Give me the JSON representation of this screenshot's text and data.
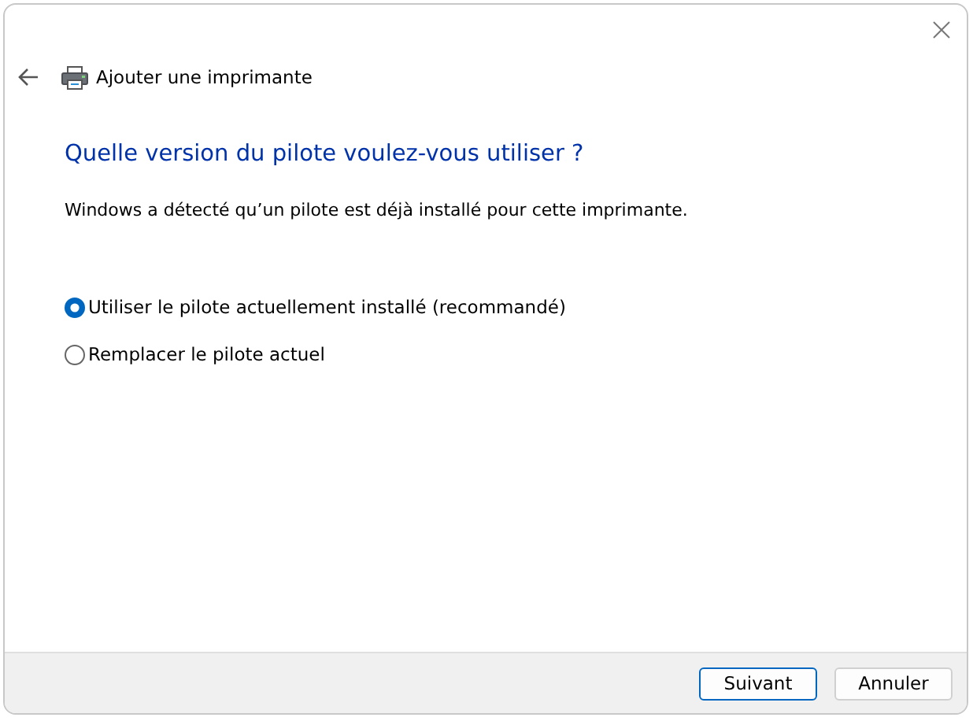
{
  "window": {
    "title": "Ajouter une imprimante"
  },
  "heading": "Quelle version du pilote voulez-vous utiliser ?",
  "description": "Windows a détecté qu’un pilote est déjà installé pour cette imprimante.",
  "options": [
    {
      "label": "Utiliser le pilote actuellement installé (recommandé)",
      "selected": true
    },
    {
      "label": "Remplacer le pilote actuel",
      "selected": false
    }
  ],
  "buttons": [
    {
      "label": "Suivant",
      "kind": "primary"
    },
    {
      "label": "Annuler",
      "kind": "secondary"
    }
  ]
}
